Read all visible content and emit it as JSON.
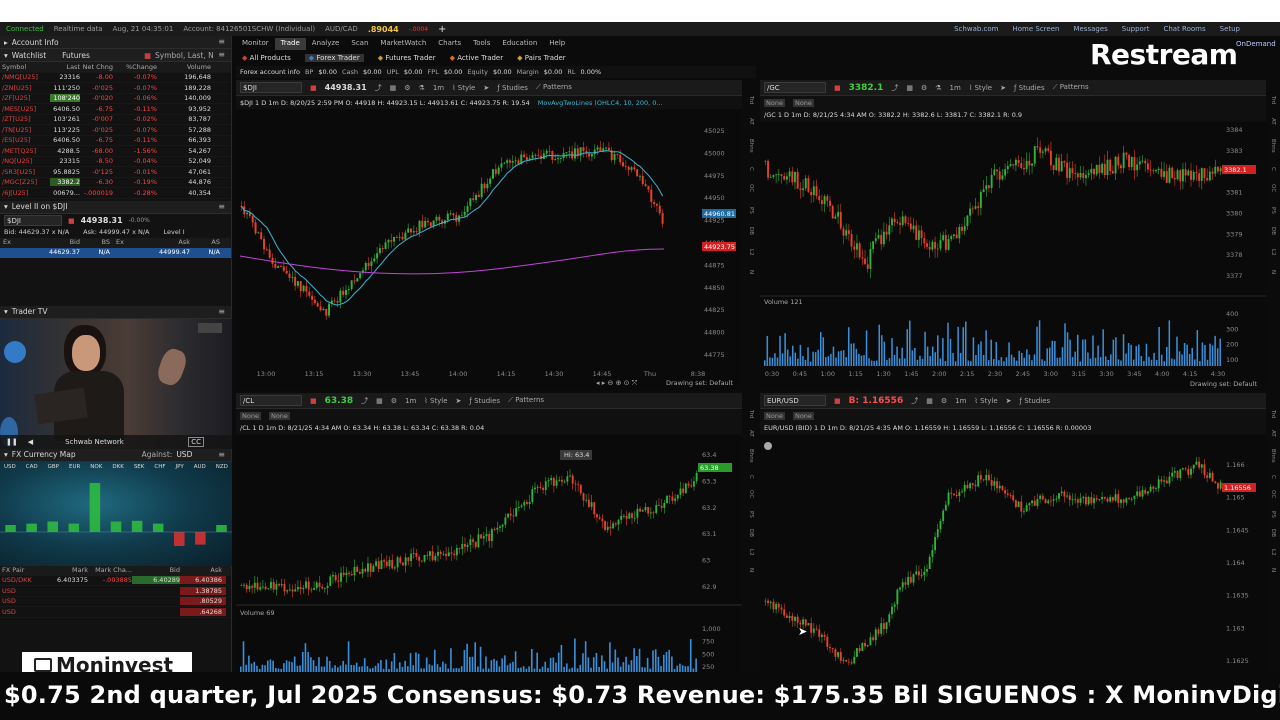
{
  "window": {
    "status": "Connected",
    "data_mode": "Realtime data",
    "datetime": "Aug, 21  04:35:01",
    "account": "Account: 84126501SCHW (Individual)",
    "pair_symbol": "AUD/CAD",
    "pair_last": ".89044",
    "pair_change": "-.0004",
    "right_links": [
      "Schwab.com",
      "Home Screen",
      "Messages",
      "Support",
      "Chat Rooms",
      "Setup"
    ]
  },
  "brand": {
    "overlay": "Restream",
    "on_demand": "OnDemand",
    "watermark": "Moninvest"
  },
  "left": {
    "account_info": "Account Info",
    "watchlist_title": "Watchlist",
    "watchlist_name": "Futures",
    "search_placeholder": "Symbol, Last, N",
    "columns": [
      "Symbol",
      "Last",
      "Net Chng",
      "%Change",
      "Volume"
    ],
    "rows": [
      [
        "/NMQ[U25]",
        "23316",
        "-8.00",
        "-0.07%",
        "196,648"
      ],
      [
        "/ZN[U25]",
        "111'250",
        "-0'025",
        "-0.07%",
        "189,228"
      ],
      [
        "/ZF[U25]",
        "108'240",
        "-0'020",
        "-0.06%",
        "140,009"
      ],
      [
        "/MES[U25]",
        "6406.50",
        "-6.75",
        "-0.11%",
        "93,952"
      ],
      [
        "/ZT[U25]",
        "103'261",
        "-0'007",
        "-0.02%",
        "83,787"
      ],
      [
        "/TN[U25]",
        "113'225",
        "-0'025",
        "-0.07%",
        "57,288"
      ],
      [
        "/ES[U25]",
        "6406.50",
        "-6.75",
        "-0.11%",
        "66,393"
      ],
      [
        "/MET[Q25]",
        "4288.5",
        "-68.00",
        "-1.56%",
        "54,267"
      ],
      [
        "/NQ[U25]",
        "23315",
        "-8.50",
        "-0.04%",
        "52,049"
      ],
      [
        "/SR3[U25]",
        "95.8825",
        "-0'125",
        "-0.01%",
        "47,061"
      ],
      [
        "/MGC[Z25]",
        "3382.2",
        "-6.30",
        "-0.19%",
        "44,876"
      ],
      [
        "/6J[U25]",
        "00679...",
        "-.000019",
        "-0.28%",
        "40,354"
      ]
    ],
    "level2_title": "Level II on $DJI",
    "level2_symbol": "$DJI",
    "level2_price": "44938.31",
    "level2_change": "-0.00%",
    "bid_label": "Bid: 44629.37 x N/A",
    "ask_label": "Ask: 44999.47 x N/A",
    "level2_tab": "Level I",
    "l2_columns": [
      "Ex",
      "Bid",
      "BS",
      "Ex",
      "Ask",
      "AS"
    ],
    "l2_row": [
      "",
      "44629.37",
      "N/A",
      "",
      "44999.47",
      "N/A"
    ],
    "trader_tv": "Trader TV",
    "tv_channel": "Schwab Network",
    "fx_map_title": "FX Currency Map",
    "fx_against_label": "Against:",
    "fx_against": "USD",
    "fx_currencies": [
      "USD",
      "CAD",
      "GBP",
      "EUR",
      "NOK",
      "DKK",
      "SEK",
      "CHF",
      "JPY",
      "AUD",
      "NZD"
    ],
    "fx_columns": [
      "FX Pair",
      "Mark",
      "Mark Cha...",
      "Bid",
      "Ask"
    ],
    "fx_rows": [
      [
        "USD/DKK",
        "6.403375",
        "-.003885",
        "6.40289",
        "6.40386"
      ],
      [
        "USD",
        "",
        "",
        "",
        "1.38785"
      ],
      [
        "USD",
        "",
        "",
        "",
        ".80529"
      ],
      [
        "USD",
        "",
        "",
        "",
        ".64268"
      ]
    ]
  },
  "nav": {
    "tabs": [
      "Monitor",
      "Trade",
      "Analyze",
      "Scan",
      "MarketWatch",
      "Charts",
      "Tools",
      "Education",
      "Help"
    ],
    "sub_tabs": [
      "All Products",
      "Forex Trader",
      "Futures Trader",
      "Active Trader",
      "Pairs Trader"
    ],
    "account_strip": [
      "Forex account info",
      "BP",
      "$0.00",
      "Cash",
      "$0.00",
      "UPL",
      "$0.00",
      "FPL",
      "$0.00",
      "Equity",
      "$0.00",
      "Margin",
      "$0.00",
      "RL",
      "0.00%"
    ]
  },
  "toolbar_labels": {
    "style": "Style",
    "studies": "Studies",
    "patterns": "Patterns",
    "interval": "1m",
    "none": "None",
    "drawing_set": "Drawing set: Default"
  },
  "charts": {
    "dji": {
      "symbol": "$DJI",
      "price": "44938.31",
      "info": "$DJI 1 D 1m   D: 8/20/25 2:59 PM   O: 44918   H: 44923.15   L: 44913.61   C: 44923.75   R: 19.54",
      "study": "MovAvgTwoLines (OHLC4, 10, 200, 0...",
      "price_tag": "44923.75",
      "ma_tag": "44960.81",
      "y_ticks": [
        "45025",
        "45000",
        "44975",
        "44950",
        "44925",
        "44900",
        "44875",
        "44850",
        "44825",
        "44800",
        "44775"
      ],
      "x_ticks": [
        "13:00",
        "13:15",
        "13:30",
        "13:45",
        "14:00",
        "14:15",
        "14:30",
        "14:45",
        "Thu",
        "8:38"
      ]
    },
    "gc": {
      "symbol": "/GC",
      "price": "3382.1",
      "info": "/GC 1 D 1m   D: 8/21/25 4:34 AM   O: 3382.2   H: 3382.6   L: 3381.7   C: 3382.1   R: 0.9",
      "price_tag": "3382.1",
      "volume_label": "Volume",
      "volume_value": "121",
      "y_ticks": [
        "3384",
        "3383",
        "3382",
        "3381",
        "3380",
        "3379",
        "3378",
        "3377"
      ],
      "v_ticks": [
        "400",
        "300",
        "200",
        "100"
      ],
      "x_ticks": [
        "0:30",
        "0:45",
        "1:00",
        "1:15",
        "1:30",
        "1:45",
        "2:00",
        "2:15",
        "2:30",
        "2:45",
        "3:00",
        "3:15",
        "3:30",
        "3:45",
        "4:00",
        "4:15",
        "4:30"
      ]
    },
    "cl": {
      "symbol": "/CL",
      "price": "63.38",
      "info": "/CL 1 D 1m   D: 8/21/25 4:34 AM   O: 63.34   H: 63.38   L: 63.34   C: 63.38   R: 0.04",
      "hi_label": "Hi: 63.4",
      "price_tag": "63.38",
      "volume_label": "Volume",
      "volume_value": "69",
      "y_ticks": [
        "63.4",
        "63.3",
        "63.2",
        "63.1",
        "63",
        "62.9"
      ],
      "v_ticks": [
        "1,000",
        "750",
        "500",
        "250"
      ]
    },
    "eurusd": {
      "symbol": "EUR/USD",
      "price": "B: 1.16556",
      "info": "EUR/USD (BID) 1 D 1m   D: 8/21/25 4:35 AM   O: 1.16559   H: 1.16559   L: 1.16556   C: 1.16556   R: 0.00003",
      "price_tag": "1.16556",
      "y_ticks": [
        "1.166",
        "1.165",
        "1.1645",
        "1.164",
        "1.1635",
        "1.163",
        "1.1625"
      ]
    }
  },
  "right_side_labels": [
    "Trd",
    "AT",
    "Bhns",
    "C",
    "OC",
    "PS",
    "DB",
    "L2",
    "N"
  ],
  "ticker": "$0.75 2nd quarter, Jul 2025 Consensus: $0.73 Revenue: $175.35 Bil     SIGUENOS :  X  MoninvDigital",
  "colors": {
    "up_candle": "#2fb33a",
    "down_candle": "#e8402a",
    "ma_fast": "#3ab7d6",
    "ma_slow": "#c045d8",
    "volume": "#3a8fd8",
    "price_tag_red": "#d32020",
    "price_tag_green": "#2a9a2a"
  }
}
